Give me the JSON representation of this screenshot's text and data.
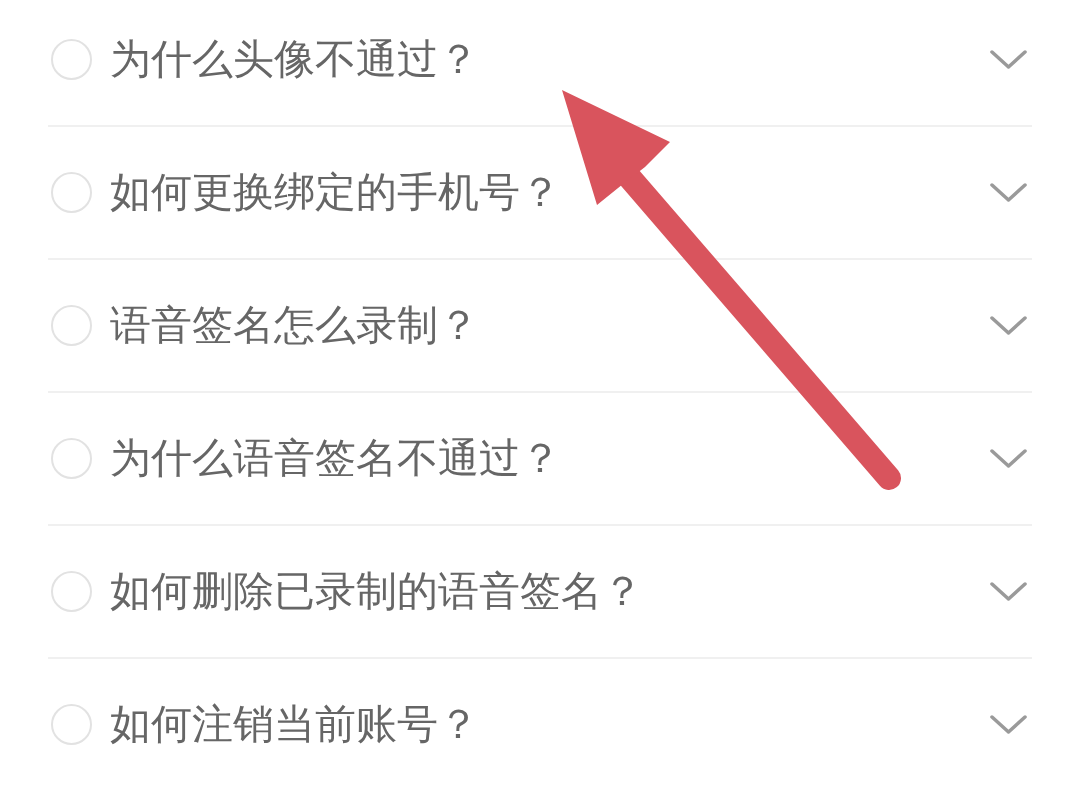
{
  "faq_items": [
    {
      "question": "为什么头像不通过？",
      "selected": false,
      "expanded": false
    },
    {
      "question": "如何更换绑定的手机号？",
      "selected": false,
      "expanded": false
    },
    {
      "question": "语音签名怎么录制？",
      "selected": false,
      "expanded": false
    },
    {
      "question": "为什么语音签名不通过？",
      "selected": false,
      "expanded": false
    },
    {
      "question": "如何删除已录制的语音签名？",
      "selected": false,
      "expanded": false
    },
    {
      "question": "如何注销当前账号？",
      "selected": false,
      "expanded": false
    }
  ]
}
